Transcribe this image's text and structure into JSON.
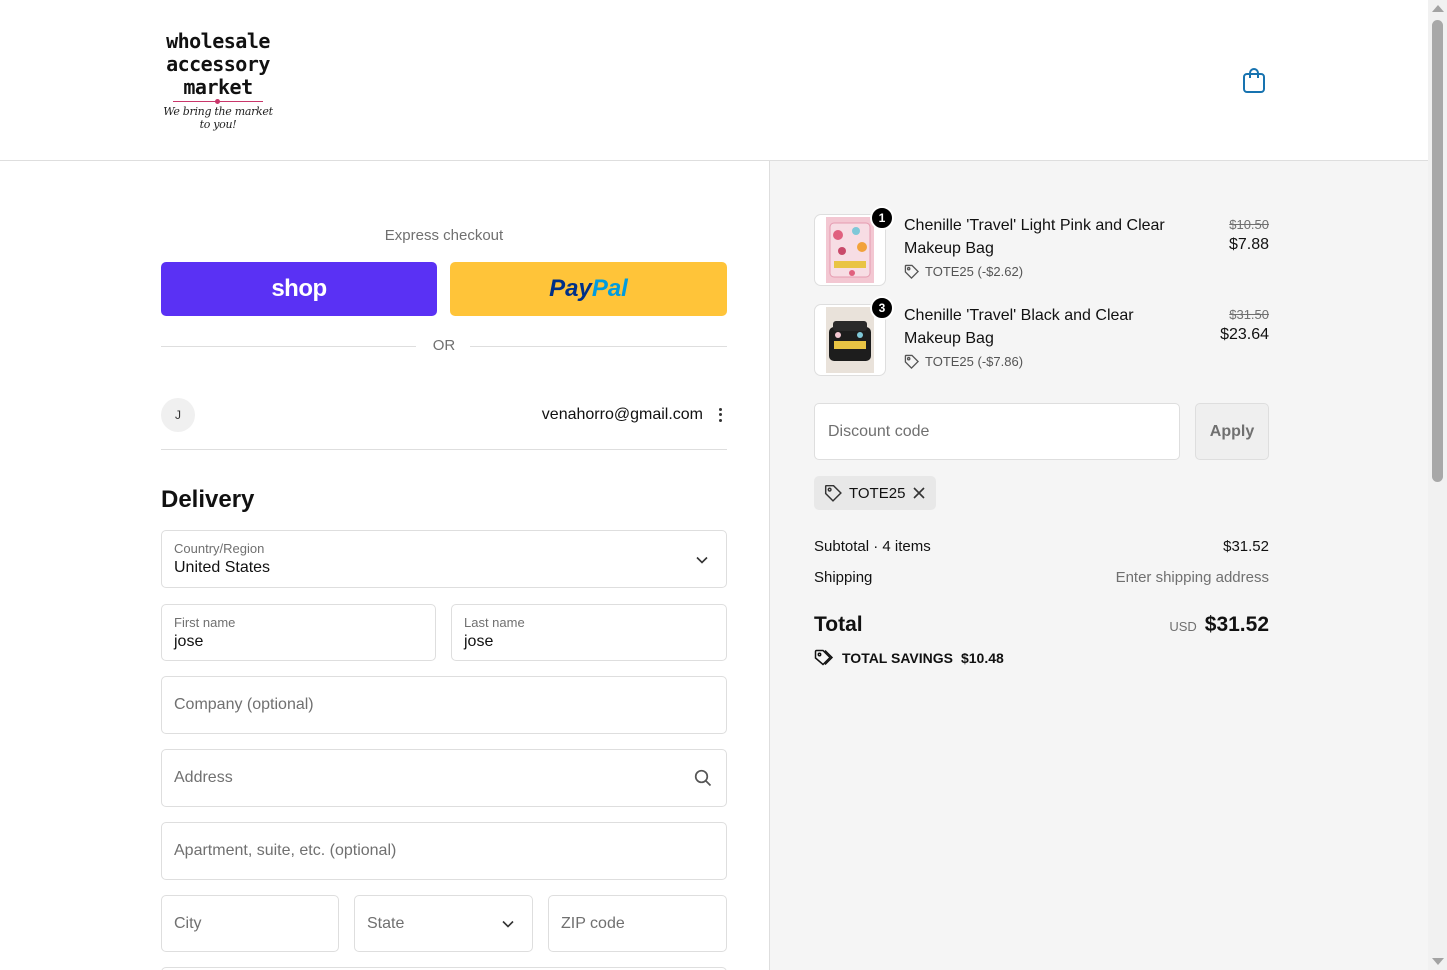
{
  "brand": {
    "logo_lines": [
      "wholesale",
      "accessory",
      "market"
    ],
    "tagline": "We bring the market to you!"
  },
  "express": {
    "label": "Express checkout",
    "shop_label": "shop",
    "paypal_a": "Pay",
    "paypal_b": "Pal",
    "or_label": "OR"
  },
  "account": {
    "initial": "J",
    "email": "venahorro@gmail.com"
  },
  "delivery": {
    "title": "Delivery",
    "country_label": "Country/Region",
    "country_value": "United States",
    "first_label": "First name",
    "first_value": "jose",
    "last_label": "Last name",
    "last_value": "jose",
    "company_placeholder": "Company (optional)",
    "address_placeholder": "Address",
    "apt_placeholder": "Apartment, suite, etc. (optional)",
    "city_placeholder": "City",
    "state_placeholder": "State",
    "zip_placeholder": "ZIP code"
  },
  "cart": {
    "items": [
      {
        "qty": "1",
        "name": "Chenille 'Travel' Light Pink and Clear Makeup Bag",
        "discount": "TOTE25 (-$2.62)",
        "old_price": "$10.50",
        "price": "$7.88"
      },
      {
        "qty": "3",
        "name": "Chenille 'Travel' Black and Clear Makeup Bag",
        "discount": "TOTE25 (-$7.86)",
        "old_price": "$31.50",
        "price": "$23.64"
      }
    ],
    "discount_placeholder": "Discount code",
    "apply_label": "Apply",
    "applied_code": "TOTE25"
  },
  "summary": {
    "subtotal_label": "Subtotal · 4 items",
    "subtotal_value": "$31.52",
    "shipping_label": "Shipping",
    "shipping_value": "Enter shipping address",
    "total_label": "Total",
    "currency": "USD",
    "total_value": "$31.52",
    "savings_label": "TOTAL SAVINGS",
    "savings_value": "$10.48"
  },
  "colors": {
    "shop_purple": "#5a31f4",
    "paypal_yellow": "#ffc439",
    "accent_blue": "#1773b0"
  }
}
